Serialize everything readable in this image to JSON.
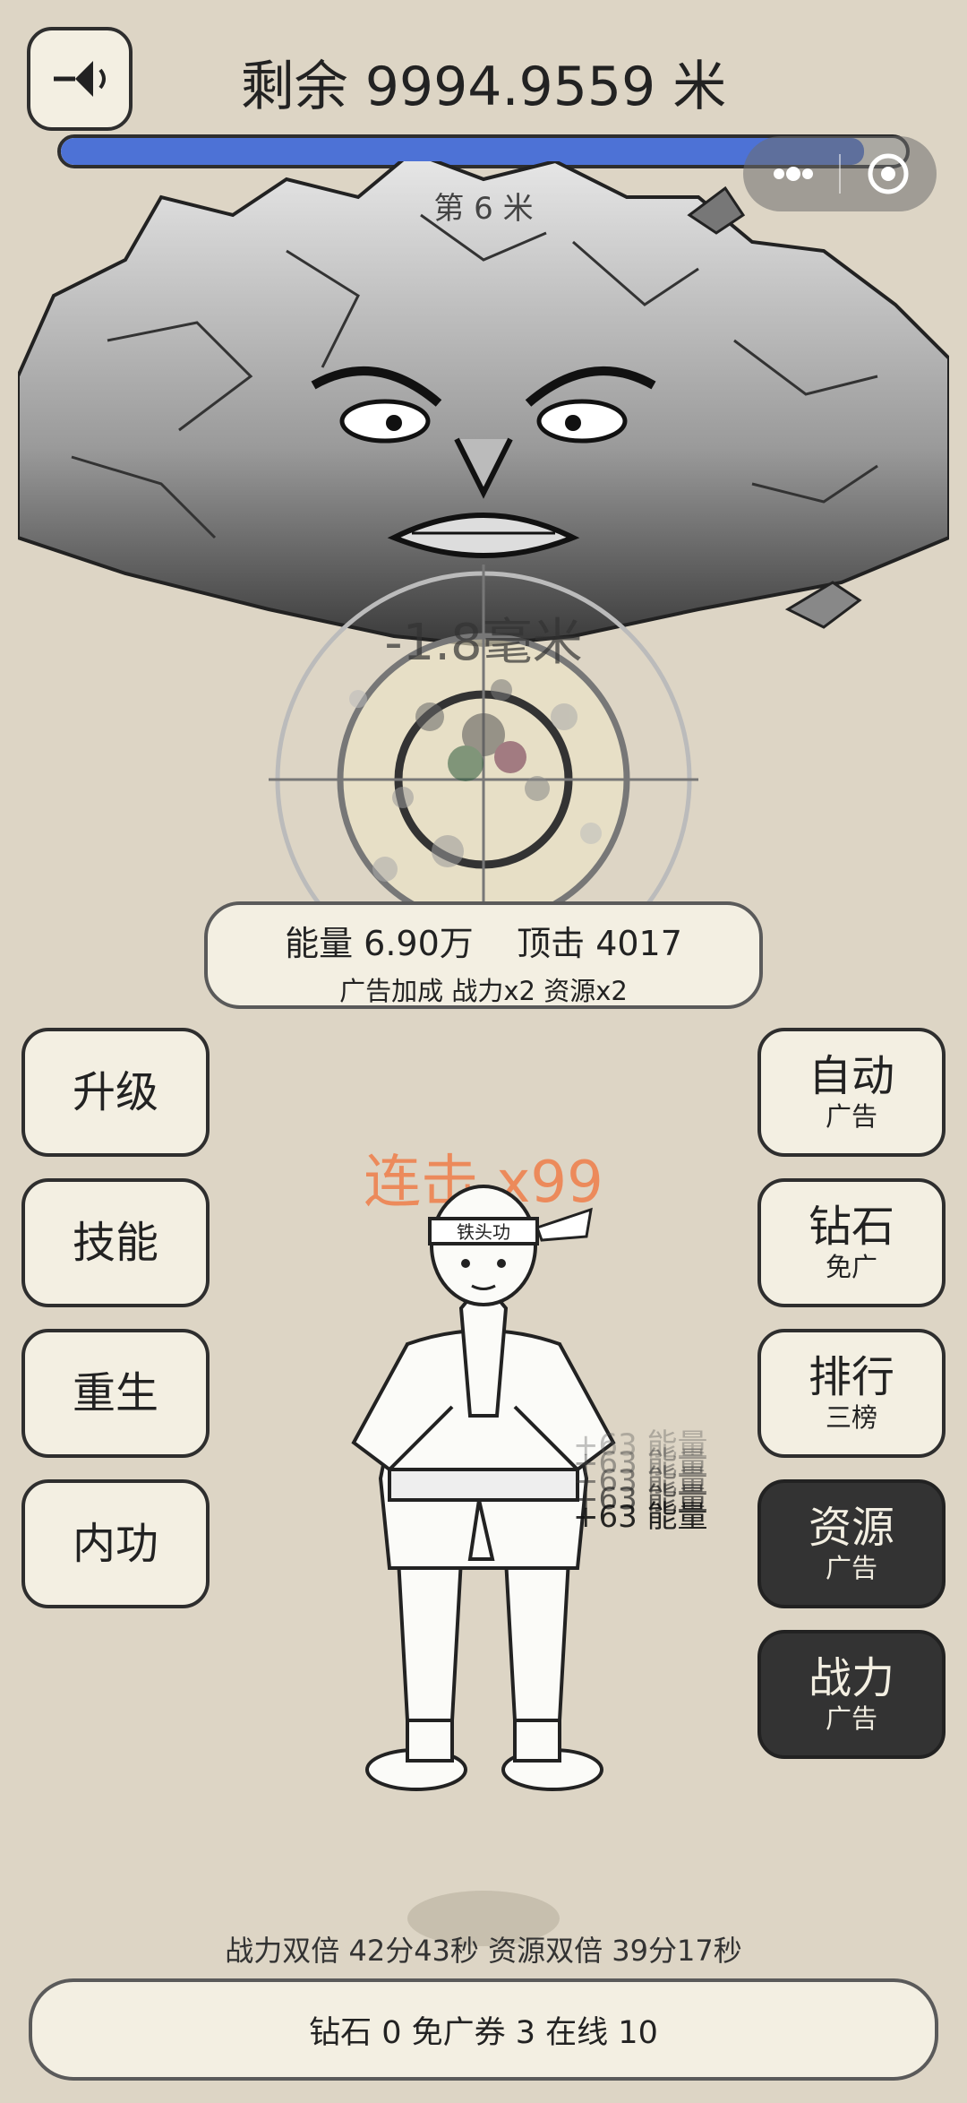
{
  "header": {
    "title": "剩余 9994.9559 米",
    "progress_fraction": 0.95,
    "stage_label": "第 6 米"
  },
  "battle": {
    "damage_text": "-1.8毫米"
  },
  "stats": {
    "energy": "能量 6.90万",
    "top_hit": "顶击 4017",
    "ad_bonus": "广告加成  战力x2  资源x2"
  },
  "left_menu": [
    {
      "label": "升级"
    },
    {
      "label": "技能"
    },
    {
      "label": "重生"
    },
    {
      "label": "内功"
    }
  ],
  "right_menu": [
    {
      "label": "自动",
      "sub": "广告",
      "style": "light"
    },
    {
      "label": "钻石",
      "sub": "免广",
      "style": "light"
    },
    {
      "label": "排行",
      "sub": "三榜",
      "style": "light"
    },
    {
      "label": "资源",
      "sub": "广告",
      "style": "dark"
    },
    {
      "label": "战力",
      "sub": "广告",
      "style": "dark"
    }
  ],
  "combo": "连击 x99",
  "hero": {
    "headband_text": "铁头功"
  },
  "energy_pop": "+63 能量",
  "timers": "战力双倍 42分43秒  资源双倍 39分17秒",
  "bottom_bar": "钻石 0   免广券 3   在线 10",
  "colors": {
    "background": "#ddd5c5",
    "panel": "#f3efe2",
    "progress": "#4d72d6",
    "combo": "#ec8a5b",
    "dark_button": "#333333"
  },
  "icons": [
    "sound-icon",
    "more-dots-icon",
    "close-circle-icon"
  ]
}
